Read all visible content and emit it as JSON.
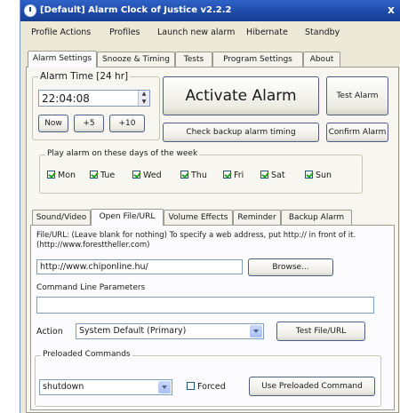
{
  "window": {
    "title": "[Default] Alarm Clock of Justice v2.2.2",
    "close_glyph": "x"
  },
  "menu": [
    "Profile Actions",
    "Profiles",
    "Launch new alarm",
    "Hibernate",
    "Standby"
  ],
  "top_tabs": [
    "Alarm Settings",
    "Snooze & Timing",
    "Tests",
    "Program Settings",
    "About"
  ],
  "alarm_time": {
    "group_title": "Alarm Time [24 hr]",
    "value": "22:04:08",
    "now_label": "Now",
    "plus5_label": "+5",
    "plus10_label": "+10"
  },
  "buttons": {
    "activate_alarm": "Activate Alarm",
    "test_alarm": "Test Alarm",
    "check_backup": "Check backup alarm timing",
    "confirm_alarm": "Confirm Alarm"
  },
  "days": {
    "group_title": "Play alarm on these days of the week",
    "items": [
      {
        "label": "Mon",
        "checked": true
      },
      {
        "label": "Tue",
        "checked": true
      },
      {
        "label": "Wed",
        "checked": true
      },
      {
        "label": "Thu",
        "checked": true
      },
      {
        "label": "Fri",
        "checked": true
      },
      {
        "label": "Sat",
        "checked": true
      },
      {
        "label": "Sun",
        "checked": true
      }
    ]
  },
  "sub_tabs": [
    "Sound/Video",
    "Open File/URL",
    "Volume Effects",
    "Reminder",
    "Backup Alarm"
  ],
  "open_file": {
    "description": "File/URL: (Leave blank for nothing) To specify a web address, put http:// in front of it. (http://www.foresttheller.com)",
    "url_value": "http://www.chiponline.hu/",
    "browse_label": "Browse...",
    "cmd_label": "Command Line Parameters",
    "cmd_value": "",
    "action_label": "Action",
    "action_value": "System Default (Primary)",
    "test_label": "Test File/URL"
  },
  "preloaded": {
    "group_title": "Preloaded Commands",
    "command_value": "shutdown",
    "forced_label": "Forced",
    "forced_checked": false,
    "use_label": "Use Preloaded Command"
  }
}
